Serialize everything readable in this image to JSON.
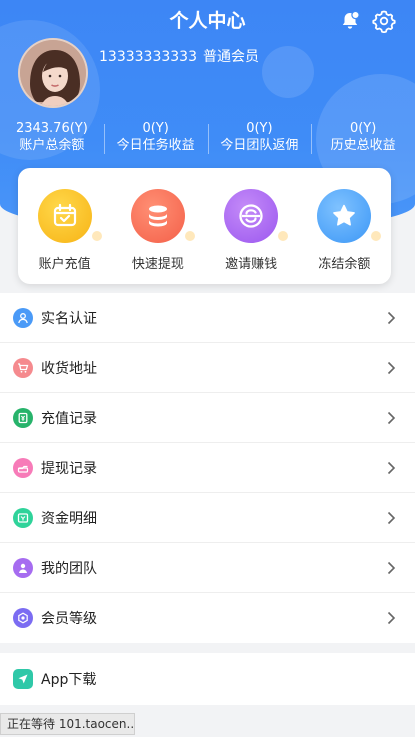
{
  "header": {
    "title": "个人中心",
    "user": {
      "phone": "13333333333",
      "level": "普通会员"
    },
    "icons": {
      "notification": "bell-icon",
      "settings": "gear-icon"
    }
  },
  "stats": [
    {
      "value": "2343.76(Y)",
      "label": "账户总余额"
    },
    {
      "value": "0(Y)",
      "label": "今日任务收益"
    },
    {
      "value": "0(Y)",
      "label": "今日团队返佣"
    },
    {
      "value": "0(Y)",
      "label": "历史总收益"
    }
  ],
  "quick_actions": [
    {
      "label": "账户充值",
      "icon": "calendar-check-icon",
      "color": "#f7b315"
    },
    {
      "label": "快速提现",
      "icon": "coin-stack-icon",
      "color": "#f46049"
    },
    {
      "label": "邀请赚钱",
      "icon": "currency-icon",
      "color": "#9b57ef"
    },
    {
      "label": "冻结余额",
      "icon": "star-icon",
      "color": "#3c97f6"
    }
  ],
  "menu": [
    {
      "label": "实名认证",
      "icon": "user-verify-icon",
      "color": "#4a9af7"
    },
    {
      "label": "收货地址",
      "icon": "cart-icon",
      "color": "#f58a8e"
    },
    {
      "label": "充值记录",
      "icon": "recharge-icon",
      "color": "#27b36b"
    },
    {
      "label": "提现记录",
      "icon": "withdraw-icon",
      "color": "#f77bb8"
    },
    {
      "label": "资金明细",
      "icon": "fund-detail-icon",
      "color": "#2fd39a"
    },
    {
      "label": "我的团队",
      "icon": "team-icon",
      "color": "#a66cf0"
    },
    {
      "label": "会员等级",
      "icon": "member-level-icon",
      "color": "#7b6cf2"
    }
  ],
  "menu_secondary": [
    {
      "label": "App下载",
      "icon": "download-send-icon",
      "color": "#2fc8a8"
    }
  ],
  "browser_status": "正在等待 101.taocen..."
}
